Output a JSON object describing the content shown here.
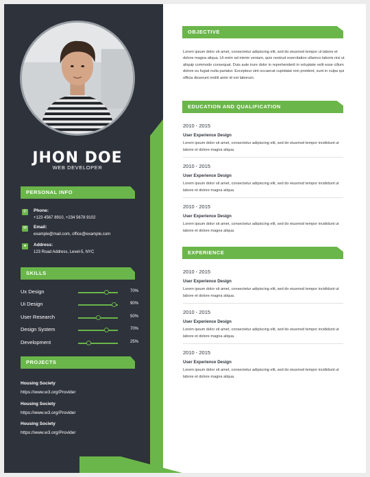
{
  "profile": {
    "name": "JHON DOE",
    "role": "WEB DEVELOPER"
  },
  "personal_info": {
    "heading": "PERSONAL INFO",
    "items": [
      {
        "icon": "phone-icon",
        "label": "Phone:",
        "value": "+123 4567 8910, +234 5678 9102"
      },
      {
        "icon": "email-icon",
        "label": "Email:",
        "value": "example@mail.com, office@example.com"
      },
      {
        "icon": "location-icon",
        "label": "Address:",
        "value": "123 Road Address, Level-5, NYC"
      }
    ]
  },
  "skills": {
    "heading": "SKILLS",
    "items": [
      {
        "name": "Ux Design",
        "percent": 70,
        "label": "70%"
      },
      {
        "name": "Ui Design",
        "percent": 90,
        "label": "90%"
      },
      {
        "name": "User Research",
        "percent": 50,
        "label": "50%"
      },
      {
        "name": "Design System",
        "percent": 70,
        "label": "70%"
      },
      {
        "name": "Development",
        "percent": 25,
        "label": "25%"
      }
    ]
  },
  "projects": {
    "heading": "PROJECTS",
    "items": [
      {
        "title": "Housing Society",
        "url": "https://www.w3.org/Provider"
      },
      {
        "title": "Housing Society",
        "url": "https://www.w3.org/Provider"
      },
      {
        "title": "Housing Society",
        "url": "https://www.w3.org/Provider"
      }
    ]
  },
  "objective": {
    "heading": "OBJECTIVE",
    "text": "Lorem ipsum dolor sit amet, consectetur adipiscing elit, sed do eiusmod tempor ut labore et dolore magna aliqua. Ut enim ad minim veniam, quis nostrud exercitation ullamco laboris nisi ut aliquip commodo consequat. Duis aute irure dolor in reprehenderit in voluptate velit esse cillum dolore eu fugiat nulla pariatur. Excepteur sint occaecat cupidatat non proident, sunt in culpa qui officia deserunt mollit anim id est laborum."
  },
  "education": {
    "heading": "EDUCATION AND QUALIFICATION",
    "items": [
      {
        "years": "2010 - 2015",
        "title": "User Experience Design",
        "desc": "Lorem ipsum dolor sit amet, consectetur adipiscing elit, sed do eiusmod tempor incididunt ut labore et dolore magna aliqua."
      },
      {
        "years": "2010 - 2015",
        "title": "User Experience Design",
        "desc": "Lorem ipsum dolor sit amet, consectetur adipiscing elit, sed do eiusmod tempor incididunt ut labore et dolore magna aliqua."
      },
      {
        "years": "2010 - 2015",
        "title": "User Experience Design",
        "desc": "Lorem ipsum dolor sit amet, consectetur adipiscing elit, sed do eiusmod tempor incididunt ut labore et dolore magna aliqua."
      }
    ]
  },
  "experience": {
    "heading": "EXPERIENCE",
    "items": [
      {
        "years": "2010 - 2015",
        "title": "User Experience Design",
        "desc": "Lorem ipsum dolor sit amet, consectetur adipiscing elit, sed do eiusmod tempor incididunt ut labore et dolore magna aliqua."
      },
      {
        "years": "2010 - 2015",
        "title": "User Experience Design",
        "desc": "Lorem ipsum dolor sit amet, consectetur adipiscing elit, sed do eiusmod tempor incididunt ut labore et dolore magna aliqua."
      },
      {
        "years": "2010 - 2015",
        "title": "User Experience Design",
        "desc": "Lorem ipsum dolor sit amet, consectetur adipiscing elit, sed do eiusmod tempor incididunt ut labore et dolore magna aliqua."
      }
    ]
  },
  "colors": {
    "accent": "#6ab64a",
    "sidebar": "#2e323b"
  }
}
